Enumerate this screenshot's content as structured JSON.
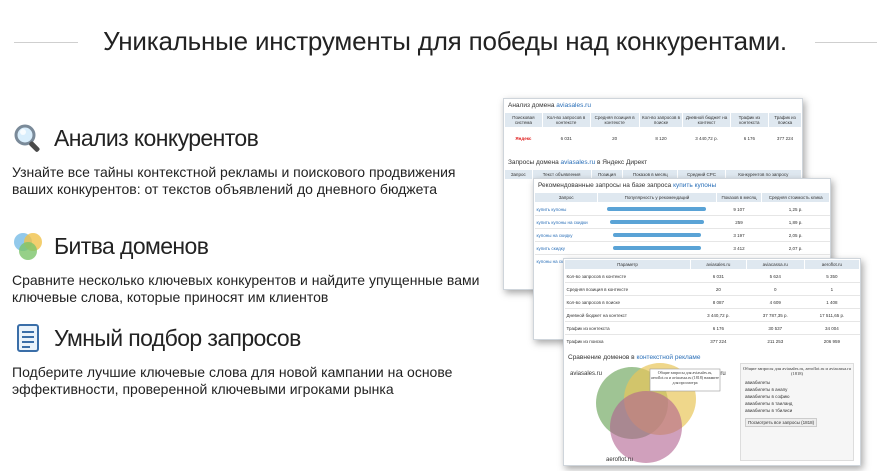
{
  "headline": "Уникальные инструменты для победы над конкурентами.",
  "features": [
    {
      "title": "Анализ конкурентов",
      "text": "Узнайте все тайны контекстной рекламы и поискового продвижения ваших конкурентов: от текстов объявлений до дневного бюджета",
      "icon": "magnifier-icon"
    },
    {
      "title": "Битва доменов",
      "text": "Сравните несколько ключевых конкурентов и найдите упущенные вами ключевые слова, которые приносят им клиентов",
      "icon": "venn-circles-icon"
    },
    {
      "title": "Умный подбор запросов",
      "text": "Подберите лучшие ключевые слова для новой кампании на основе эффективности, проверенной ключевыми игроками рынка",
      "icon": "document-list-icon"
    }
  ],
  "shot1": {
    "title_prefix": "Анализ домена ",
    "domain": "aviasales.ru",
    "headers": [
      "Поисковая система",
      "Кол-во запросов в контексте",
      "Средняя позиция в контексте",
      "Кол-во запросов в поиске",
      "Дневной бюджет на контекст",
      "Трафик из контекста",
      "Трафик из поиска"
    ],
    "row": [
      "Яндекс",
      "6 031",
      "20",
      "8 120",
      "3 440,72 р.",
      "6 176",
      "377 224"
    ],
    "sub_title_prefix": "Запросы домена ",
    "sub_title_suffix": " в Яндекс Директ",
    "sub_headers": [
      "Запрос",
      "Текст объявления",
      "Позиция",
      "Показов в месяц",
      "Средний CPC",
      "Конкурентов по запросу"
    ]
  },
  "shot2": {
    "title_prefix": "Рекомендованные запросы на базе запроса ",
    "query": "купить купоны",
    "headers": [
      "Запрос",
      "Популярность у рекомендаций",
      "Показов в месяц",
      "Средняя стоимость клика"
    ],
    "rows": [
      {
        "q": "купить купоны",
        "pop": 0.9,
        "shows": "9 107",
        "cpc": "1,25 р."
      },
      {
        "q": "купить купоны на скидки",
        "pop": 0.85,
        "shows": "259",
        "cpc": "1,89 р."
      },
      {
        "q": "купоны на скидку",
        "pop": 0.8,
        "shows": "3 197",
        "cpc": "2,05 р."
      },
      {
        "q": "купить скидку",
        "pop": 0.8,
        "shows": "3 412",
        "cpc": "2,07 р."
      },
      {
        "q": "купоны на скидки",
        "pop": 0.75,
        "shows": "1 127",
        "cpc": "2,12 р."
      }
    ]
  },
  "shot3": {
    "headers": [
      "Параметр",
      "aviasales.ru",
      "aviacassa.ru",
      "aeroflot.ru"
    ],
    "rows": [
      [
        "Кол-во запросов в контексте",
        "6 031",
        "5 624",
        "5 350"
      ],
      [
        "Средняя позиция в контексте",
        "20",
        "0",
        "1"
      ],
      [
        "Кол-во запросов в поиске",
        "8 087",
        "4 609",
        "1 408"
      ],
      [
        "Дневной бюджет на контекст",
        "3 440,72 р.",
        "37 787,35 р.",
        "17 511,65 р."
      ],
      [
        "Трафик из контекста",
        "6 176",
        "30 537",
        "34 004"
      ],
      [
        "Трафик из поиска",
        "377 224",
        "211 253",
        "206 959"
      ]
    ],
    "venn_title_prefix": "Сравнение доменов в ",
    "venn_title_link": "контекстной рекламе",
    "venn_labels": [
      "aviasales.ru",
      "aviacassa.ru",
      "aeroflot.ru"
    ],
    "tooltip": "Общие запросы для aviasales.ru, aeroflot.ru и aviacassa.ru (1818) нажмите для просмотра",
    "side_title": "Общие запросы для aviasales.ru, aeroflot.ru и aviacassa.ru (1818)",
    "side_items": [
      "авиабилеты",
      "авиабилеты в анапу",
      "авиабилеты в софию",
      "авиабилеты в таиланд",
      "авиабилеты в тбилиси"
    ],
    "side_button": "Посмотреть все запросы (1818)"
  },
  "colors": {
    "link": "#2a6fb8",
    "table_header": "#dfe8f0",
    "bar": "#5aa3d6"
  }
}
